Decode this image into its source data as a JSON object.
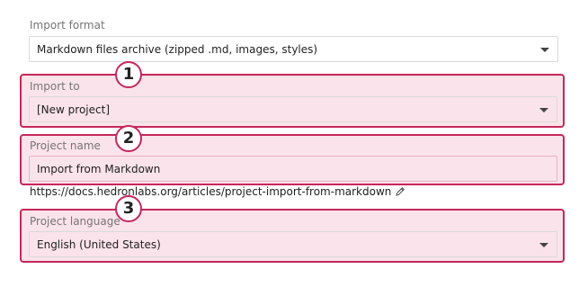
{
  "import_format": {
    "label": "Import format",
    "value": "Markdown files archive (zipped .md, images, styles)"
  },
  "import_to": {
    "label": "Import to",
    "value": "[New project]",
    "badge": "1"
  },
  "project_name": {
    "label": "Project name",
    "value": "Import from Markdown",
    "badge": "2",
    "url": "https://docs.hedronlabs.org/articles/project-import-from-markdown"
  },
  "project_language": {
    "label": "Project language",
    "value": "English (United States)",
    "badge": "3"
  },
  "colors": {
    "highlight_border": "#c5285a",
    "highlight_fill": "#f3b0c7"
  },
  "icons": {
    "dropdown": "chevron-down-icon",
    "edit": "pencil-icon"
  }
}
